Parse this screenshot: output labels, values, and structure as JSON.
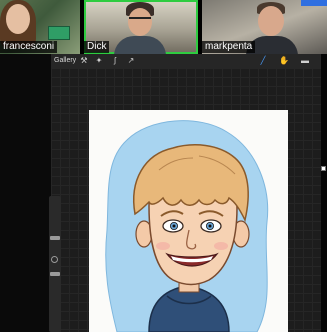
{
  "participants": [
    {
      "name": "francesconi",
      "active": false
    },
    {
      "name": "Dick",
      "active": true
    },
    {
      "name": "markpenta",
      "active": false
    }
  ],
  "toolbar": {
    "gallery_label": "Gallery",
    "tools_left": [
      "wrench-icon",
      "magic-wand-icon",
      "selection-icon",
      "transform-icon"
    ],
    "tools_right": [
      "brush-icon",
      "smudge-icon",
      "eraser-icon"
    ]
  },
  "colors": {
    "active_brush": "#4a9dff",
    "active_speaker": "#2ecc40",
    "canvas_bg": "#1d1d1d",
    "caricature_background": "#a8d4f0"
  }
}
